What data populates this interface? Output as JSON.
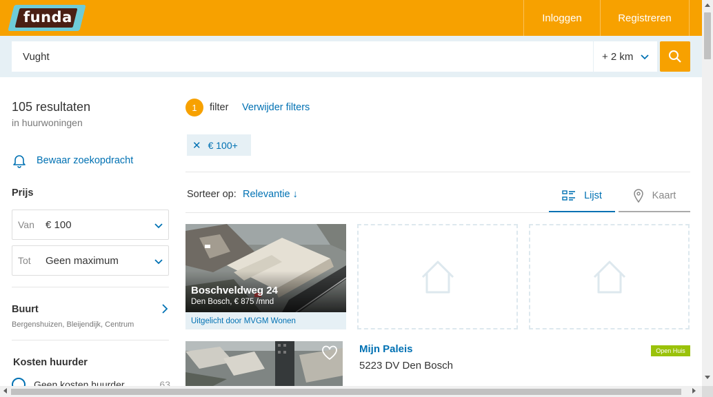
{
  "header": {
    "logo_text": "funda",
    "login_label": "Inloggen",
    "register_label": "Registreren"
  },
  "search": {
    "value": "Vught",
    "radius": "+ 2 km"
  },
  "sidebar": {
    "results_count": "105 resultaten",
    "results_sub": "in huurwoningen",
    "save_search": "Bewaar zoekopdracht",
    "price_title": "Prijs",
    "price_from_label": "Van",
    "price_from_value": "€ 100",
    "price_to_label": "Tot",
    "price_to_value": "Geen maximum",
    "buurt_title": "Buurt",
    "buurt_sub": "Bergenshuizen, Bleijendijk, Centrum",
    "costs_title": "Kosten huurder",
    "costs_option": "Geen kosten huurder",
    "costs_count": "63"
  },
  "filters": {
    "count": "1",
    "word": "filter",
    "remove_label": "Verwijder filters",
    "chip_label": "€ 100+"
  },
  "sort": {
    "label": "Sorteer op:",
    "value": "Relevantie ↓"
  },
  "view_tabs": {
    "list": "Lijst",
    "map": "Kaart"
  },
  "featured": {
    "title": "Boschveldweg 24",
    "subtitle": "Den Bosch, € 875 /mnd",
    "footer": "Uitgelicht door MVGM Wonen"
  },
  "listing": {
    "title": "Mijn Paleis",
    "address": "5223 DV Den Bosch",
    "badge": "Open Huis"
  },
  "colors": {
    "brand_orange": "#f7a100",
    "link_blue": "#0071b3",
    "light_blue_bg": "#e6f0f5",
    "badge_green": "#9ac20a"
  }
}
